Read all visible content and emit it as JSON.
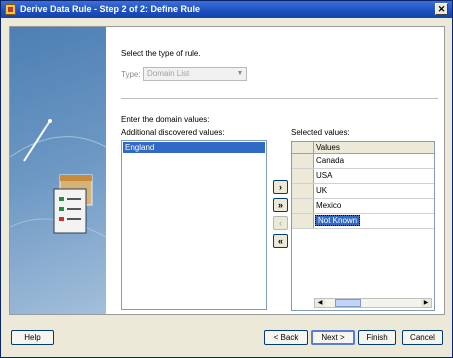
{
  "window": {
    "title": "Derive Data Rule - Step 2 of 2: Define Rule",
    "close_glyph": "✕"
  },
  "rule": {
    "prompt": "Select the type of rule.",
    "type_label": "Type:",
    "type_value": "Domain List"
  },
  "domain": {
    "prompt": "Enter the domain values:",
    "discovered_label": "Additional discovered values:",
    "discovered_items": [
      "England"
    ],
    "selected_label": "Selected values:",
    "table": {
      "column": "Values",
      "rows": [
        "Canada",
        "USA",
        "UK",
        "Mexico",
        "Not Known"
      ]
    }
  },
  "move_buttons": {
    "add": "›",
    "add_all": "»",
    "remove": "‹",
    "remove_all": "«"
  },
  "footer": {
    "help": "Help",
    "back": "< Back",
    "next": "Next >",
    "finish": "Finish",
    "cancel": "Cancel"
  }
}
